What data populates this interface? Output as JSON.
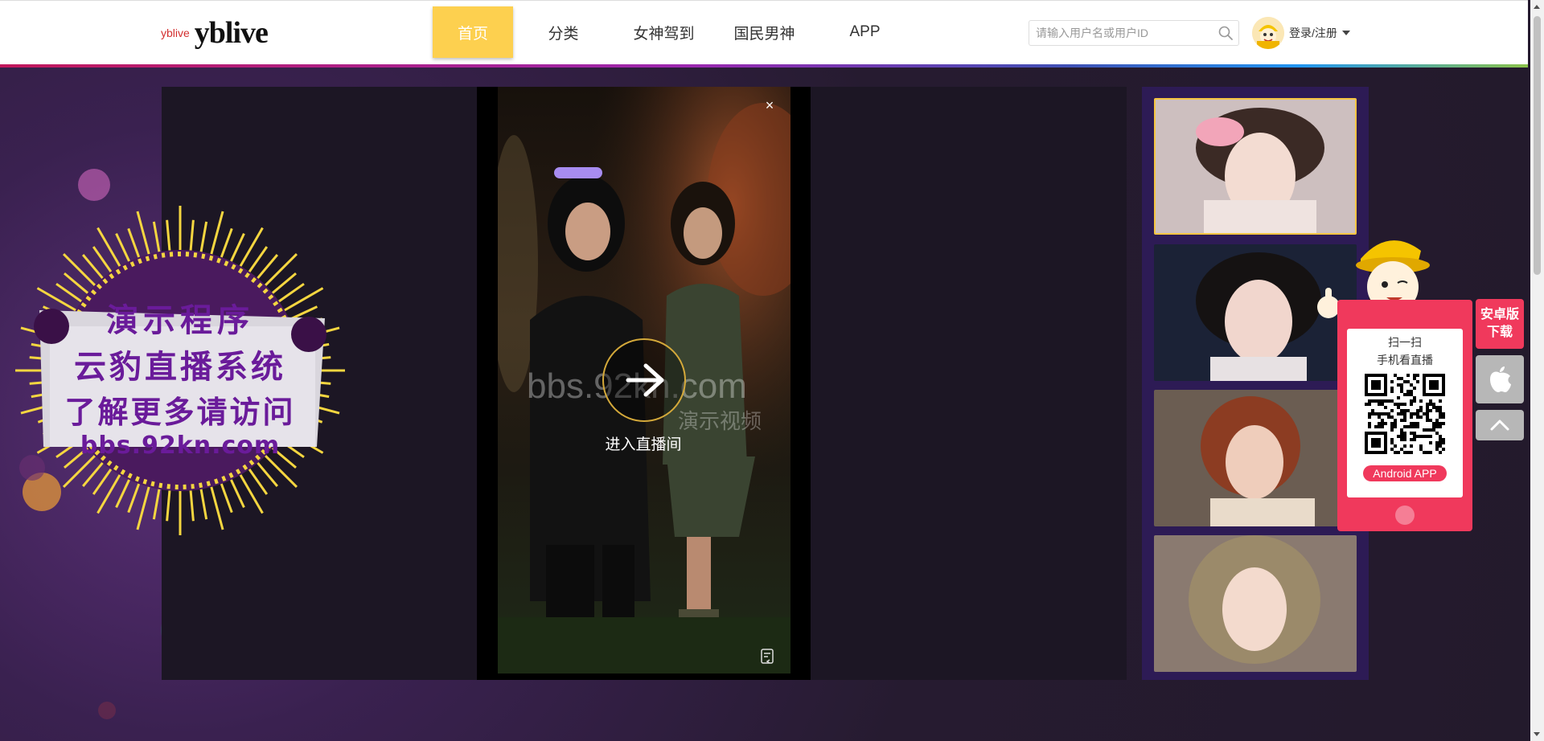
{
  "header": {
    "logo_small": "yblive",
    "logo_text": "yblive",
    "nav": [
      {
        "label": "首页",
        "active": true
      },
      {
        "label": "分类",
        "active": false
      },
      {
        "label": "女神驾到",
        "active": false
      },
      {
        "label": "国民男神",
        "active": false
      },
      {
        "label": "APP",
        "active": false
      }
    ],
    "search_placeholder": "请输入用户名或用户ID",
    "login_label": "登录/注册"
  },
  "banner": {
    "line1": "演示程序",
    "line2": "云豹直播系统",
    "line3": "了解更多请访问",
    "line4": "bbs.92kn.com"
  },
  "player": {
    "watermark": "bbs.92kn.com",
    "watermark_sub": "演示视频",
    "enter_label": "进入直播间",
    "close_symbol": "×"
  },
  "download": {
    "scan_title": "扫一扫",
    "scan_sub": "手机看直播",
    "android_app_label": "Android APP",
    "side_android_line1": "安卓版",
    "side_android_line2": "下载"
  },
  "colors": {
    "accent_yellow": "#fdd04f",
    "accent_pink": "#f0395c",
    "thumb_panel": "#2d1b55"
  }
}
